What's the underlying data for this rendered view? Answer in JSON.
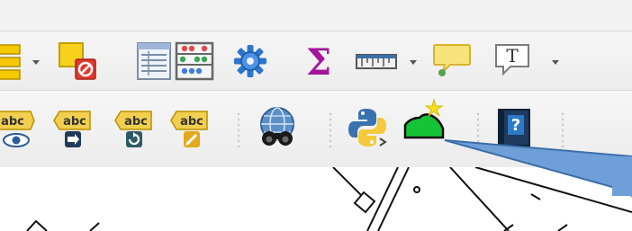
{
  "toolbar_primary": {
    "buttons": [
      {
        "name": "layer-order-button",
        "icon": "stacked-layers-icon"
      },
      {
        "name": "deselect-features-button",
        "icon": "deselect-icon"
      },
      {
        "name": "attribute-table-button",
        "icon": "table-icon"
      },
      {
        "name": "field-calculator-button",
        "icon": "abacus-icon"
      },
      {
        "name": "processing-toolbox-button",
        "icon": "gear-icon"
      },
      {
        "name": "statistics-button",
        "icon": "sigma-icon"
      },
      {
        "name": "measure-button",
        "icon": "ruler-icon"
      },
      {
        "name": "map-tips-button",
        "icon": "speech-bubble-icon"
      },
      {
        "name": "text-annotation-button",
        "icon": "text-annotation-icon"
      }
    ],
    "text_annotation_glyph": "T"
  },
  "toolbar_labels": {
    "buttons": [
      {
        "name": "label-toolbar-button",
        "icon": "abc-eye-icon",
        "text": "abc"
      },
      {
        "name": "pin-labels-button",
        "icon": "abc-arrow-icon",
        "text": "abc"
      },
      {
        "name": "rotate-label-button",
        "icon": "abc-rotate-icon",
        "text": "abc"
      },
      {
        "name": "change-label-button",
        "icon": "abc-pencil-icon",
        "text": "abc"
      },
      {
        "name": "geocoder-search-button",
        "icon": "globe-binoculars-icon"
      },
      {
        "name": "python-console-button",
        "icon": "python-icon"
      },
      {
        "name": "plugin-button",
        "icon": "green-shape-star-icon"
      },
      {
        "name": "help-button",
        "icon": "help-book-icon",
        "text": "?"
      }
    ]
  },
  "colors": {
    "callout_fill": "#6f9fd8",
    "callout_stroke": "#3c6ea8",
    "toolbar_bg": "#efefef",
    "sigma": "#a3169b",
    "help_blue": "#2c79c7"
  }
}
